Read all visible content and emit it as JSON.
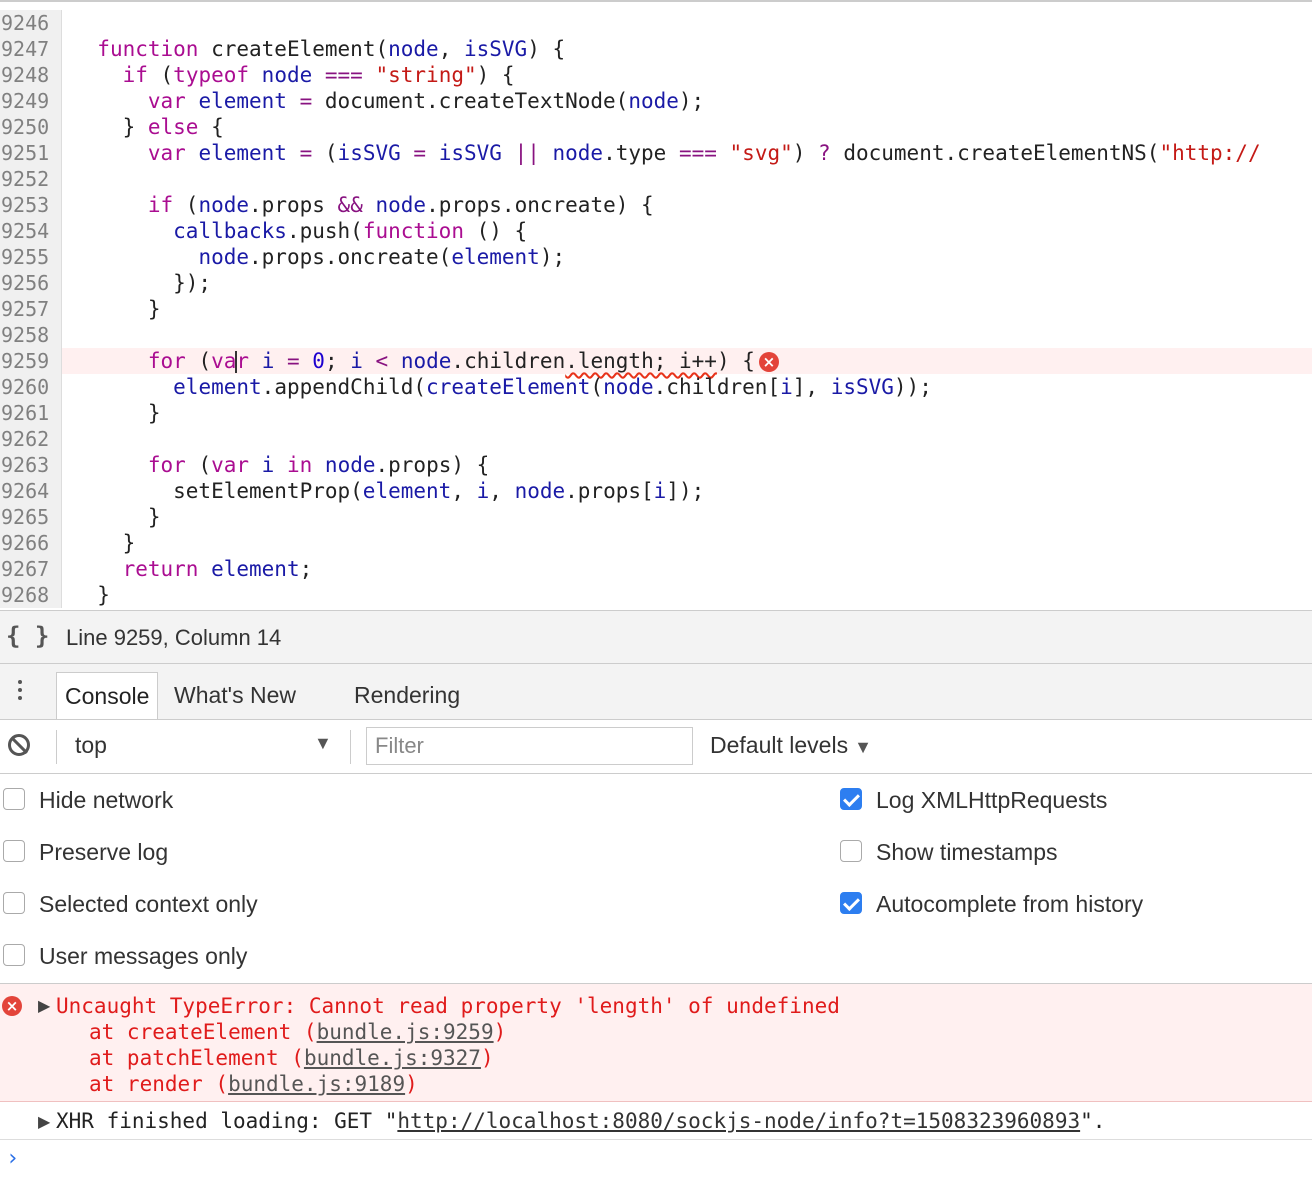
{
  "editor": {
    "lines": [
      {
        "num": "9246",
        "error": false,
        "tokens": [
          {
            "t": "  ",
            "c": "p"
          }
        ]
      },
      {
        "num": "9247",
        "error": false,
        "tokens": [
          {
            "t": "  ",
            "c": "p"
          },
          {
            "t": "function",
            "c": "kw"
          },
          {
            "t": " createElement(",
            "c": "p"
          },
          {
            "t": "node",
            "c": "v"
          },
          {
            "t": ", ",
            "c": "p"
          },
          {
            "t": "isSVG",
            "c": "v"
          },
          {
            "t": ") {",
            "c": "p"
          }
        ]
      },
      {
        "num": "9248",
        "error": false,
        "tokens": [
          {
            "t": "    ",
            "c": "p"
          },
          {
            "t": "if",
            "c": "kw"
          },
          {
            "t": " (",
            "c": "p"
          },
          {
            "t": "typeof",
            "c": "kw"
          },
          {
            "t": " node ",
            "c": "v"
          },
          {
            "t": "===",
            "c": "op"
          },
          {
            "t": " ",
            "c": "p"
          },
          {
            "t": "\"string\"",
            "c": "str"
          },
          {
            "t": ") {",
            "c": "p"
          }
        ]
      },
      {
        "num": "9249",
        "error": false,
        "tokens": [
          {
            "t": "      ",
            "c": "p"
          },
          {
            "t": "var",
            "c": "kw"
          },
          {
            "t": " element ",
            "c": "v"
          },
          {
            "t": "=",
            "c": "op"
          },
          {
            "t": " document.createTextNode(",
            "c": "p"
          },
          {
            "t": "node",
            "c": "v"
          },
          {
            "t": ");",
            "c": "p"
          }
        ]
      },
      {
        "num": "9250",
        "error": false,
        "tokens": [
          {
            "t": "    } ",
            "c": "p"
          },
          {
            "t": "else",
            "c": "kw"
          },
          {
            "t": " {",
            "c": "p"
          }
        ]
      },
      {
        "num": "9251",
        "error": false,
        "tokens": [
          {
            "t": "      ",
            "c": "p"
          },
          {
            "t": "var",
            "c": "kw"
          },
          {
            "t": " element ",
            "c": "v"
          },
          {
            "t": "=",
            "c": "op"
          },
          {
            "t": " (",
            "c": "p"
          },
          {
            "t": "isSVG",
            "c": "v"
          },
          {
            "t": " = ",
            "c": "op"
          },
          {
            "t": "isSVG",
            "c": "v"
          },
          {
            "t": " || ",
            "c": "op"
          },
          {
            "t": "node",
            "c": "v"
          },
          {
            "t": ".type ",
            "c": "p"
          },
          {
            "t": "===",
            "c": "op"
          },
          {
            "t": " ",
            "c": "p"
          },
          {
            "t": "\"svg\"",
            "c": "str"
          },
          {
            "t": ") ",
            "c": "p"
          },
          {
            "t": "?",
            "c": "op"
          },
          {
            "t": " document.createElementNS(",
            "c": "p"
          },
          {
            "t": "\"http://",
            "c": "str"
          }
        ]
      },
      {
        "num": "9252",
        "error": false,
        "tokens": [
          {
            "t": " ",
            "c": "p"
          }
        ]
      },
      {
        "num": "9253",
        "error": false,
        "tokens": [
          {
            "t": "      ",
            "c": "p"
          },
          {
            "t": "if",
            "c": "kw"
          },
          {
            "t": " (",
            "c": "p"
          },
          {
            "t": "node",
            "c": "v"
          },
          {
            "t": ".props ",
            "c": "p"
          },
          {
            "t": "&&",
            "c": "op"
          },
          {
            "t": " ",
            "c": "p"
          },
          {
            "t": "node",
            "c": "v"
          },
          {
            "t": ".props.oncreate) {",
            "c": "p"
          }
        ]
      },
      {
        "num": "9254",
        "error": false,
        "tokens": [
          {
            "t": "        ",
            "c": "p"
          },
          {
            "t": "callbacks",
            "c": "v"
          },
          {
            "t": ".push(",
            "c": "p"
          },
          {
            "t": "function",
            "c": "kw"
          },
          {
            "t": " () {",
            "c": "p"
          }
        ]
      },
      {
        "num": "9255",
        "error": false,
        "tokens": [
          {
            "t": "          ",
            "c": "p"
          },
          {
            "t": "node",
            "c": "v"
          },
          {
            "t": ".props.oncreate(",
            "c": "p"
          },
          {
            "t": "element",
            "c": "v"
          },
          {
            "t": ");",
            "c": "p"
          }
        ]
      },
      {
        "num": "9256",
        "error": false,
        "tokens": [
          {
            "t": "        });",
            "c": "p"
          }
        ]
      },
      {
        "num": "9257",
        "error": false,
        "tokens": [
          {
            "t": "      }",
            "c": "p"
          }
        ]
      },
      {
        "num": "9258",
        "error": false,
        "tokens": [
          {
            "t": " ",
            "c": "p"
          }
        ]
      },
      {
        "num": "9259",
        "error": true,
        "tokens": [
          {
            "t": "      ",
            "c": "p"
          },
          {
            "t": "for",
            "c": "kw"
          },
          {
            "t": " (",
            "c": "p"
          },
          {
            "t": "va",
            "c": "kw"
          },
          {
            "t": "|",
            "c": "cursor"
          },
          {
            "t": "r",
            "c": "kw"
          },
          {
            "t": " i ",
            "c": "v"
          },
          {
            "t": "=",
            "c": "op"
          },
          {
            "t": " ",
            "c": "p"
          },
          {
            "t": "0",
            "c": "num"
          },
          {
            "t": "; ",
            "c": "p"
          },
          {
            "t": "i",
            "c": "v"
          },
          {
            "t": " < ",
            "c": "op"
          },
          {
            "t": "node",
            "c": "v"
          },
          {
            "t": ".children",
            "c": "p"
          },
          {
            "t": ".length; i++",
            "c": "squig"
          },
          {
            "t": ") {",
            "c": "p"
          },
          {
            "t": "x",
            "c": "erricon"
          }
        ]
      },
      {
        "num": "9260",
        "error": false,
        "tokens": [
          {
            "t": "        ",
            "c": "p"
          },
          {
            "t": "element",
            "c": "v"
          },
          {
            "t": ".appendChild(",
            "c": "p"
          },
          {
            "t": "createElement",
            "c": "fn"
          },
          {
            "t": "(",
            "c": "p"
          },
          {
            "t": "node",
            "c": "v"
          },
          {
            "t": ".children[",
            "c": "p"
          },
          {
            "t": "i",
            "c": "v"
          },
          {
            "t": "], ",
            "c": "p"
          },
          {
            "t": "isSVG",
            "c": "v"
          },
          {
            "t": "));",
            "c": "p"
          }
        ]
      },
      {
        "num": "9261",
        "error": false,
        "tokens": [
          {
            "t": "      }",
            "c": "p"
          }
        ]
      },
      {
        "num": "9262",
        "error": false,
        "tokens": [
          {
            "t": " ",
            "c": "p"
          }
        ]
      },
      {
        "num": "9263",
        "error": false,
        "tokens": [
          {
            "t": "      ",
            "c": "p"
          },
          {
            "t": "for",
            "c": "kw"
          },
          {
            "t": " (",
            "c": "p"
          },
          {
            "t": "var",
            "c": "kw"
          },
          {
            "t": " i ",
            "c": "v"
          },
          {
            "t": "in",
            "c": "kw"
          },
          {
            "t": " ",
            "c": "p"
          },
          {
            "t": "node",
            "c": "v"
          },
          {
            "t": ".props) {",
            "c": "p"
          }
        ]
      },
      {
        "num": "9264",
        "error": false,
        "tokens": [
          {
            "t": "        setElementProp(",
            "c": "p"
          },
          {
            "t": "element",
            "c": "v"
          },
          {
            "t": ", ",
            "c": "p"
          },
          {
            "t": "i",
            "c": "v"
          },
          {
            "t": ", ",
            "c": "p"
          },
          {
            "t": "node",
            "c": "v"
          },
          {
            "t": ".props[",
            "c": "p"
          },
          {
            "t": "i",
            "c": "v"
          },
          {
            "t": "]);",
            "c": "p"
          }
        ]
      },
      {
        "num": "9265",
        "error": false,
        "tokens": [
          {
            "t": "      }",
            "c": "p"
          }
        ]
      },
      {
        "num": "9266",
        "error": false,
        "tokens": [
          {
            "t": "    }",
            "c": "p"
          }
        ]
      },
      {
        "num": "9267",
        "error": false,
        "tokens": [
          {
            "t": "    ",
            "c": "p"
          },
          {
            "t": "return",
            "c": "kw"
          },
          {
            "t": " ",
            "c": "p"
          },
          {
            "t": "element",
            "c": "v"
          },
          {
            "t": ";",
            "c": "p"
          }
        ]
      },
      {
        "num": "9268",
        "error": false,
        "tokens": [
          {
            "t": "  }",
            "c": "p"
          }
        ]
      }
    ]
  },
  "statusbar": {
    "braces_icon": "{ }",
    "cursor_position": "Line 9259, Column 14"
  },
  "drawer": {
    "tabs": [
      "Console",
      "What's New",
      "Rendering"
    ],
    "active_tab": "Console"
  },
  "toolbar": {
    "context": "top",
    "filter_placeholder": "Filter",
    "levels": "Default levels"
  },
  "settings": {
    "left": [
      {
        "label": "Hide network",
        "checked": false
      },
      {
        "label": "Preserve log",
        "checked": false
      },
      {
        "label": "Selected context only",
        "checked": false
      },
      {
        "label": "User messages only",
        "checked": false
      }
    ],
    "right": [
      {
        "label": "Log XMLHttpRequests",
        "checked": true
      },
      {
        "label": "Show timestamps",
        "checked": false
      },
      {
        "label": "Autocomplete from history",
        "checked": true
      }
    ]
  },
  "messages": {
    "error": {
      "title": "Uncaught TypeError: Cannot read property 'length' of undefined",
      "frames": [
        {
          "prefix": "at createElement (",
          "link": "bundle.js:9259",
          "suffix": ")"
        },
        {
          "prefix": "at patchElement (",
          "link": "bundle.js:9327",
          "suffix": ")"
        },
        {
          "prefix": "at render (",
          "link": "bundle.js:9189",
          "suffix": ")"
        }
      ]
    },
    "xhr": {
      "prefix": "XHR finished loading: GET \"",
      "url": "http://localhost:8080/sockjs-node/info?t=1508323960893",
      "suffix": "\"."
    },
    "prompt": "›"
  },
  "colors": {
    "error_text": "#e01b1b",
    "error_bg": "#fff0f0",
    "checkbox_checked": "#2d7ef0",
    "keyword": "#aa0d91",
    "string": "#c41a16"
  }
}
